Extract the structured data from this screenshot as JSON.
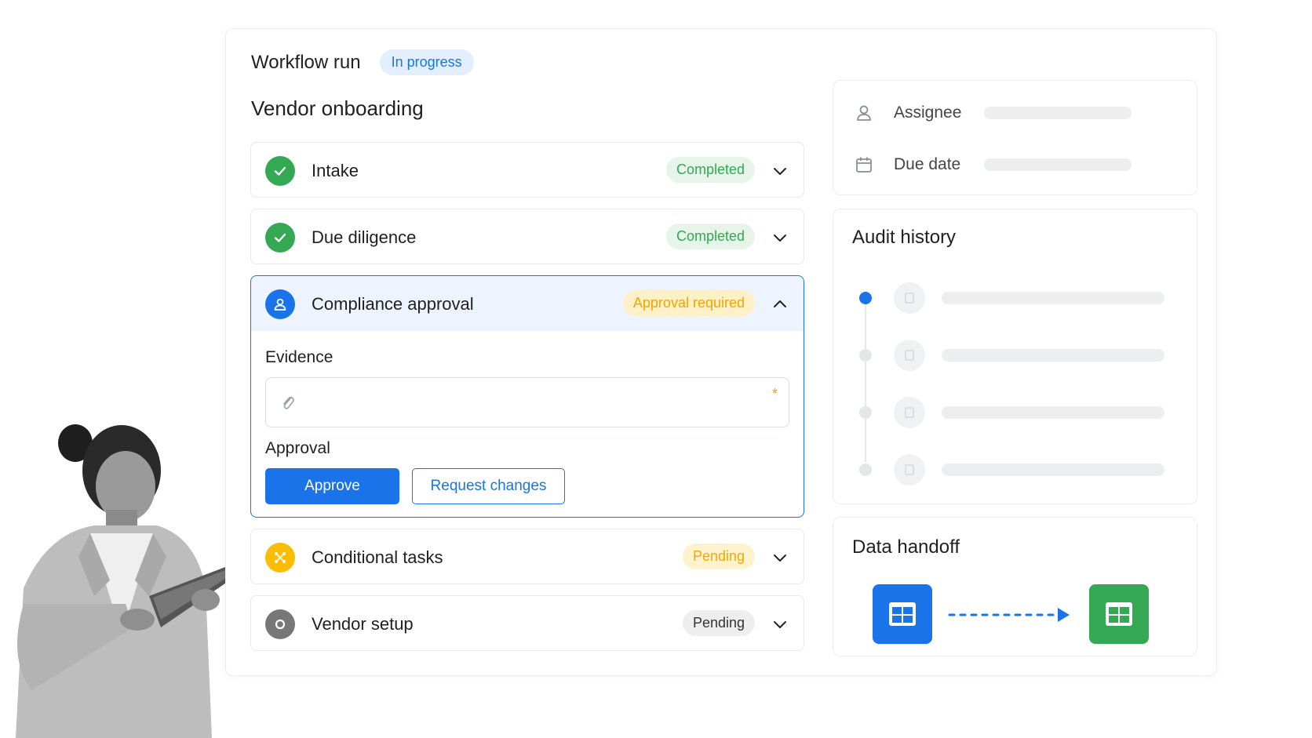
{
  "header": {
    "title": "Workflow run",
    "status": "In progress"
  },
  "section": {
    "title": "Vendor onboarding"
  },
  "steps": [
    {
      "label": "Intake",
      "status": "Completed"
    },
    {
      "label": "Due diligence",
      "status": "Completed"
    },
    {
      "label": "Compliance approval",
      "status": "Approval required",
      "evidence_label": "Evidence",
      "required_marker": "*",
      "approval_label": "Approval",
      "approve_button": "Approve",
      "request_changes_button": "Request changes"
    },
    {
      "label": "Conditional tasks",
      "status": "Pending"
    },
    {
      "label": "Vendor setup",
      "status": "Pending"
    }
  ],
  "meta": {
    "assignee_label": "Assignee",
    "due_date_label": "Due date"
  },
  "audit": {
    "title": "Audit history"
  },
  "handoff": {
    "title": "Data handoff"
  },
  "colors": {
    "accent": "#1a73e8",
    "success": "#34a853",
    "warning": "#f5a300",
    "neutral": "#777777"
  }
}
